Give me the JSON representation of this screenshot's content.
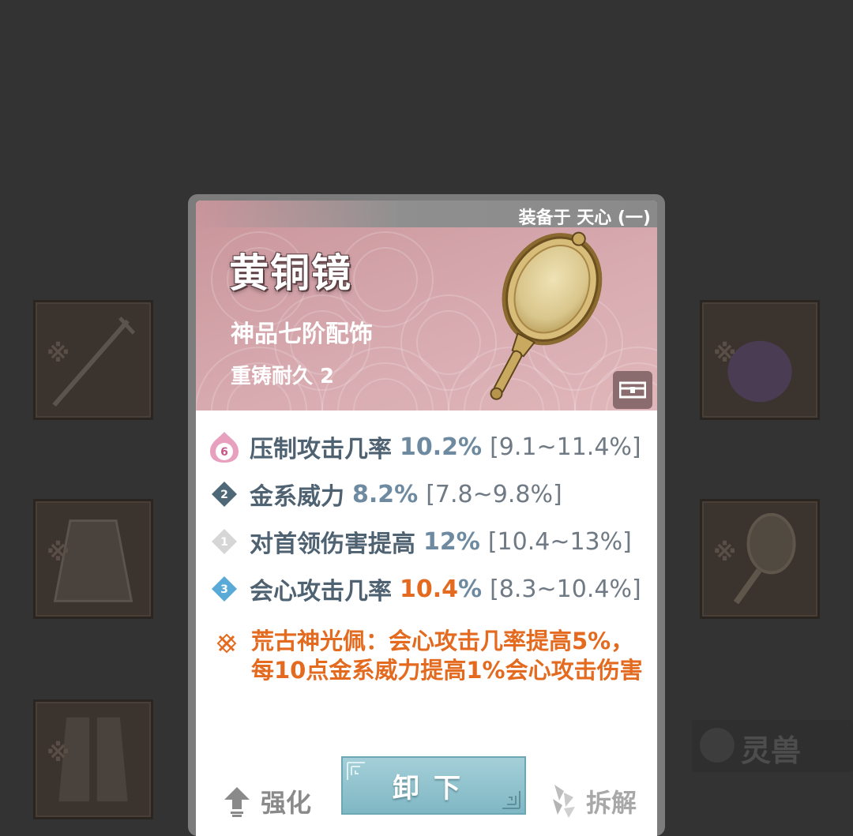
{
  "background": {
    "side_tab_label": "灵兽"
  },
  "tooltip": {
    "equipped_on": "装备于 天心 (一)",
    "item_name": "黄铜镜",
    "item_grade": "神品七阶配饰",
    "durability": "重铸耐久 2",
    "stats": [
      {
        "badge": "6",
        "badge_icon": "lotus-badge-icon",
        "name": "压制攻击几率",
        "value": "10.2%",
        "range": "[9.1~11.4%]",
        "is_max": false
      },
      {
        "badge": "2",
        "badge_icon": "diamond-badge-icon",
        "name": "金系威力",
        "value": "8.2%",
        "range": "[7.8~9.8%]",
        "is_max": false
      },
      {
        "badge": "1",
        "badge_icon": "diamond-badge-icon",
        "name": "对首领伤害提高",
        "value": "12%",
        "range": "[10.4~13%]",
        "is_max": false
      },
      {
        "badge": "3",
        "badge_icon": "diamond-badge-icon",
        "name": "会心攻击几率",
        "value_number": "10.4",
        "value_unit": "%",
        "range": "[8.3~10.4%]",
        "is_max": true
      }
    ],
    "set_bonus": "荒古神光佩：会心攻击几率提高5%，每10点金系威力提高1%会心攻击伤害",
    "actions": {
      "enhance": "强化",
      "unequip": "卸下",
      "dismantle": "拆解"
    }
  },
  "colors": {
    "header_pink": "#d7aaaf",
    "stat_text": "#4f6272",
    "highlight_orange": "#e36a1e",
    "button_teal": "#8ec1cc"
  }
}
